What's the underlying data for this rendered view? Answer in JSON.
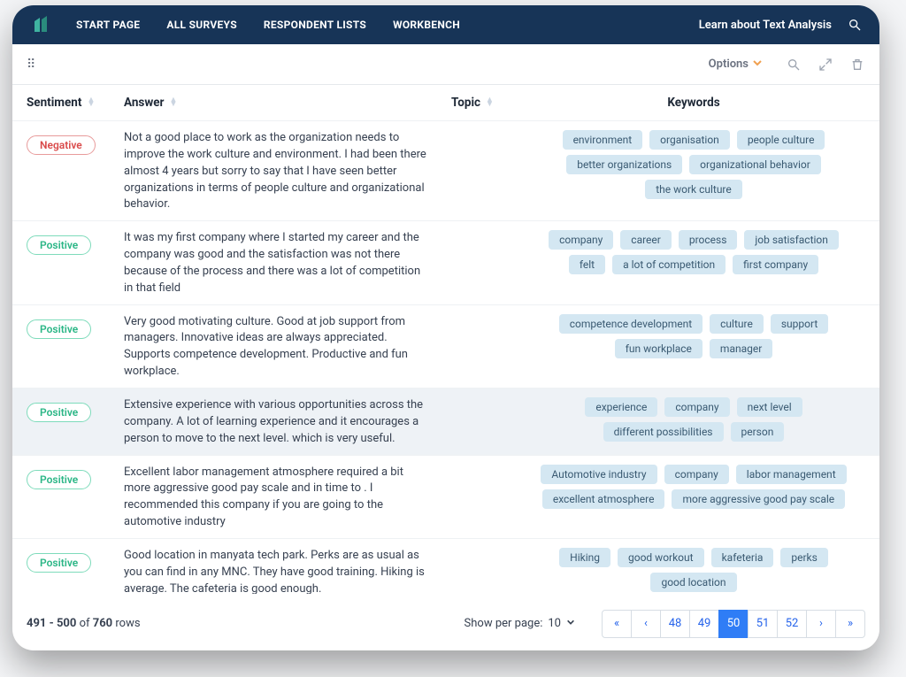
{
  "topnav": {
    "items": [
      "START PAGE",
      "ALL SURVEYS",
      "RESPONDENT LISTS",
      "WORKBENCH"
    ],
    "learn": "Learn about Text Analysis"
  },
  "toolbar": {
    "options_label": "Options"
  },
  "columns": {
    "sentiment": "Sentiment",
    "answer": "Answer",
    "topic": "Topic",
    "keywords": "Keywords"
  },
  "rows": [
    {
      "sentiment": "Negative",
      "sent_class": "neg",
      "answer": "Not a good place to work as the organization needs to improve the work culture and environment. I had been there almost 4 years but sorry to say that I have seen better organizations in terms of people culture and organizational behavior.",
      "keywords": [
        "environment",
        "organisation",
        "people culture",
        "better organizations",
        "organizational behavior",
        "the work culture"
      ],
      "highlight": false
    },
    {
      "sentiment": "Positive",
      "sent_class": "pos",
      "answer": "It was my first company where I started my career and the company was good and the satisfaction was not there because of the process and there was a lot of competition in that field",
      "keywords": [
        "company",
        "career",
        "process",
        "job satisfaction",
        "felt",
        "a lot of competition",
        "first company"
      ],
      "highlight": false
    },
    {
      "sentiment": "Positive",
      "sent_class": "pos",
      "answer": "Very good motivating culture. Good at job support from managers. Innovative ideas are always appreciated. Supports competence development. Productive and fun workplace.",
      "keywords": [
        "competence development",
        "culture",
        "support",
        "fun workplace",
        "manager"
      ],
      "highlight": false
    },
    {
      "sentiment": "Positive",
      "sent_class": "pos",
      "answer": "Extensive experience with various opportunities across the company. A lot of learning experience and it encourages a person to move to the next level. which is very useful.",
      "keywords": [
        "experience",
        "company",
        "next level",
        "different possibilities",
        "person"
      ],
      "highlight": true
    },
    {
      "sentiment": "Positive",
      "sent_class": "pos",
      "answer": "Excellent labor management atmosphere required a bit more aggressive good pay scale and in time to . I recommended this company if you are going to the automotive industry",
      "keywords": [
        "Automotive industry",
        "company",
        "labor management",
        "excellent atmosphere",
        "more aggressive good pay scale"
      ],
      "highlight": false
    },
    {
      "sentiment": "Positive",
      "sent_class": "pos",
      "answer": "Good location in manyata tech park. Perks are as usual as you can find in any MNC. They have good training. Hiking is average. The cafeteria is good enough.",
      "keywords": [
        "Hiking",
        "good workout",
        "kafeteria",
        "perks",
        "good location"
      ],
      "highlight": false,
      "truncate": true
    }
  ],
  "footer": {
    "range": "491 - 500",
    "of": "of",
    "total": "760",
    "rows": "rows",
    "per_page_label": "Show per page:",
    "per_page_value": "10",
    "pages": [
      "«",
      "‹",
      "48",
      "49",
      "50",
      "51",
      "52",
      "›",
      "»"
    ],
    "selected_page": "50"
  }
}
